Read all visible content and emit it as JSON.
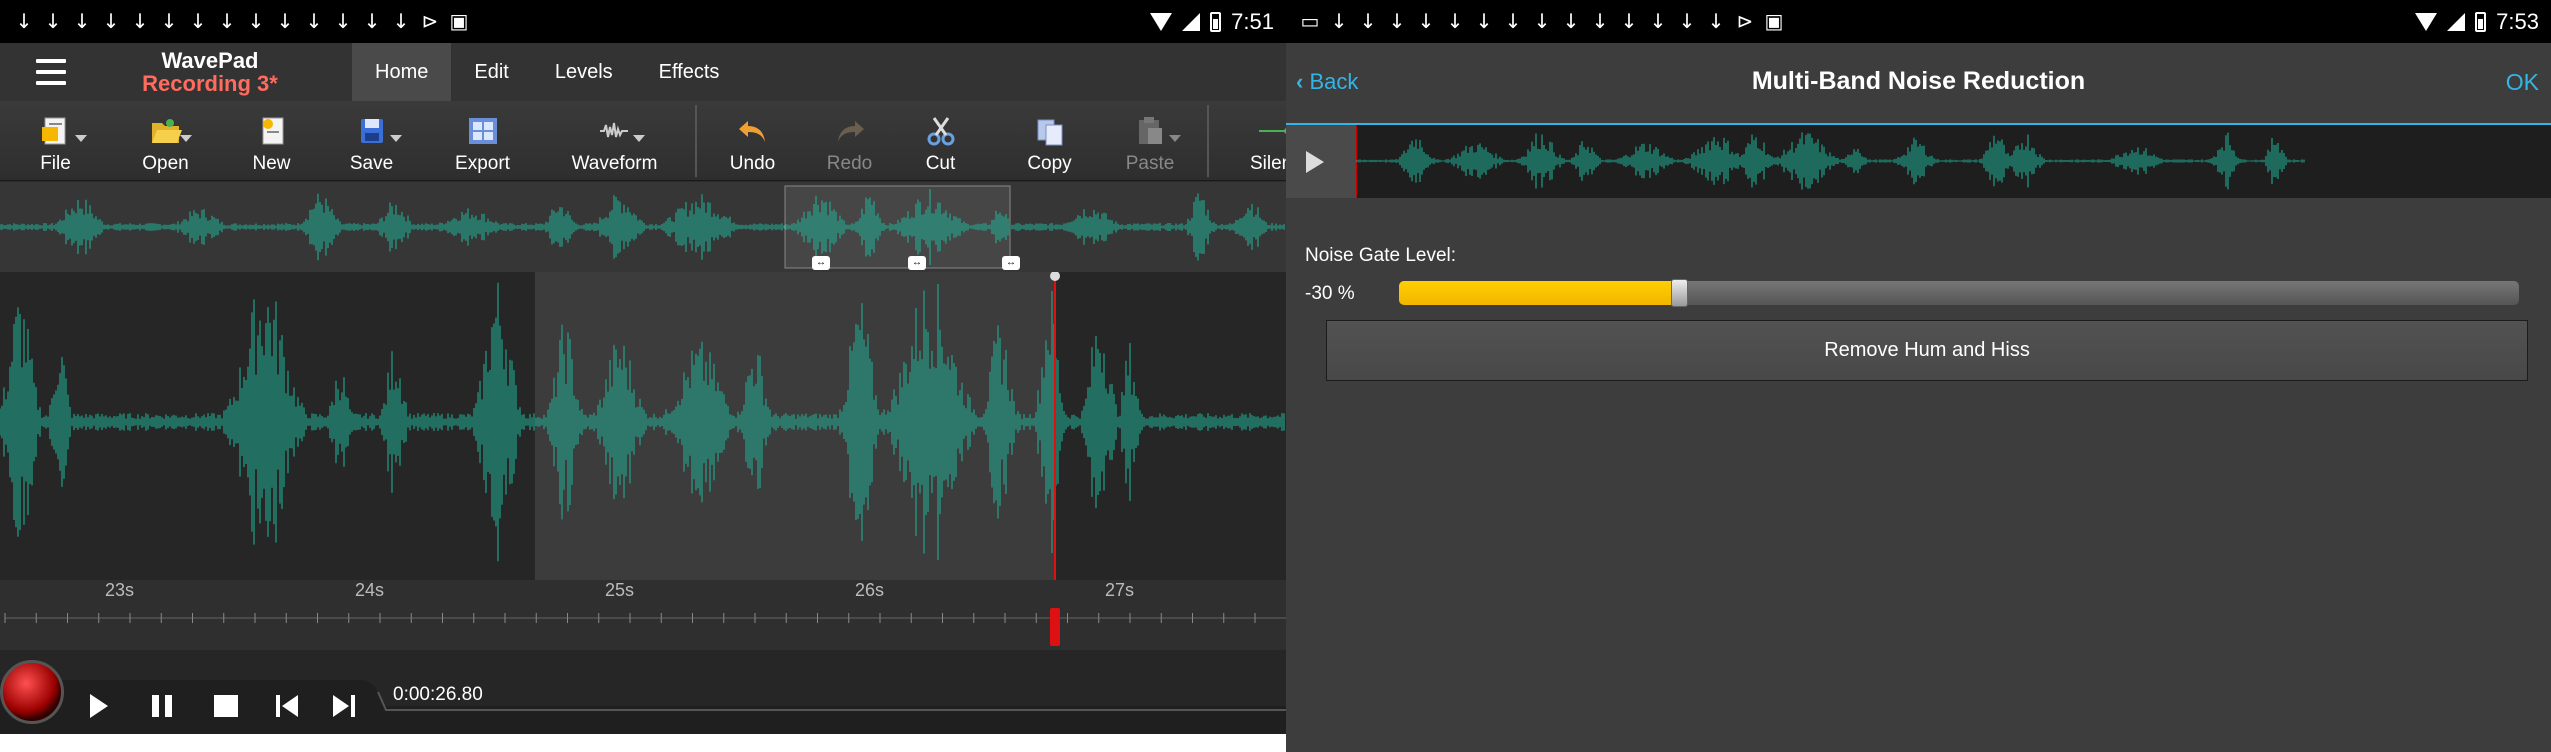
{
  "left": {
    "status": {
      "icons": [
        "↓",
        "↓",
        "↓",
        "↓",
        "↓",
        "↓",
        "↓",
        "↓",
        "↓",
        "↓",
        "↓",
        "↓",
        "↓",
        "↓",
        "⊳",
        "▣"
      ],
      "time": "7:51"
    },
    "app": {
      "name": "WavePad",
      "document": "Recording 3*"
    },
    "tabs": [
      "Home",
      "Edit",
      "Levels",
      "Effects"
    ],
    "toolbar": {
      "file": "File",
      "open": "Open",
      "new": "New",
      "save": "Save",
      "export": "Export",
      "waveform": "Waveform",
      "undo": "Undo",
      "redo": "Redo",
      "cut": "Cut",
      "copy": "Copy",
      "paste": "Paste",
      "silence": "Silen"
    },
    "timeline": {
      "labels": [
        "23s",
        "24s",
        "25s",
        "26s",
        "27s"
      ]
    },
    "transport": {
      "time": "0:00:26.80"
    },
    "colors": {
      "wave": "#1fb59a",
      "accent": "#ff6b5f",
      "cursor": "#e01010"
    }
  },
  "right": {
    "status": {
      "icons": [
        "▭",
        "↓",
        "↓",
        "↓",
        "↓",
        "↓",
        "↓",
        "↓",
        "↓",
        "↓",
        "↓",
        "↓",
        "↓",
        "↓",
        "↓",
        "⊳",
        "▣"
      ],
      "time": "7:53"
    },
    "back": "Back",
    "title": "Multi-Band Noise Reduction",
    "ok": "OK",
    "noise_gate_label": "Noise Gate Level:",
    "noise_gate_value": "-30 %",
    "noise_gate_fraction": 0.25,
    "remove_button": "Remove Hum and Hiss",
    "colors": {
      "link": "#33b5e5",
      "slider_fill": "#ffc400"
    }
  }
}
